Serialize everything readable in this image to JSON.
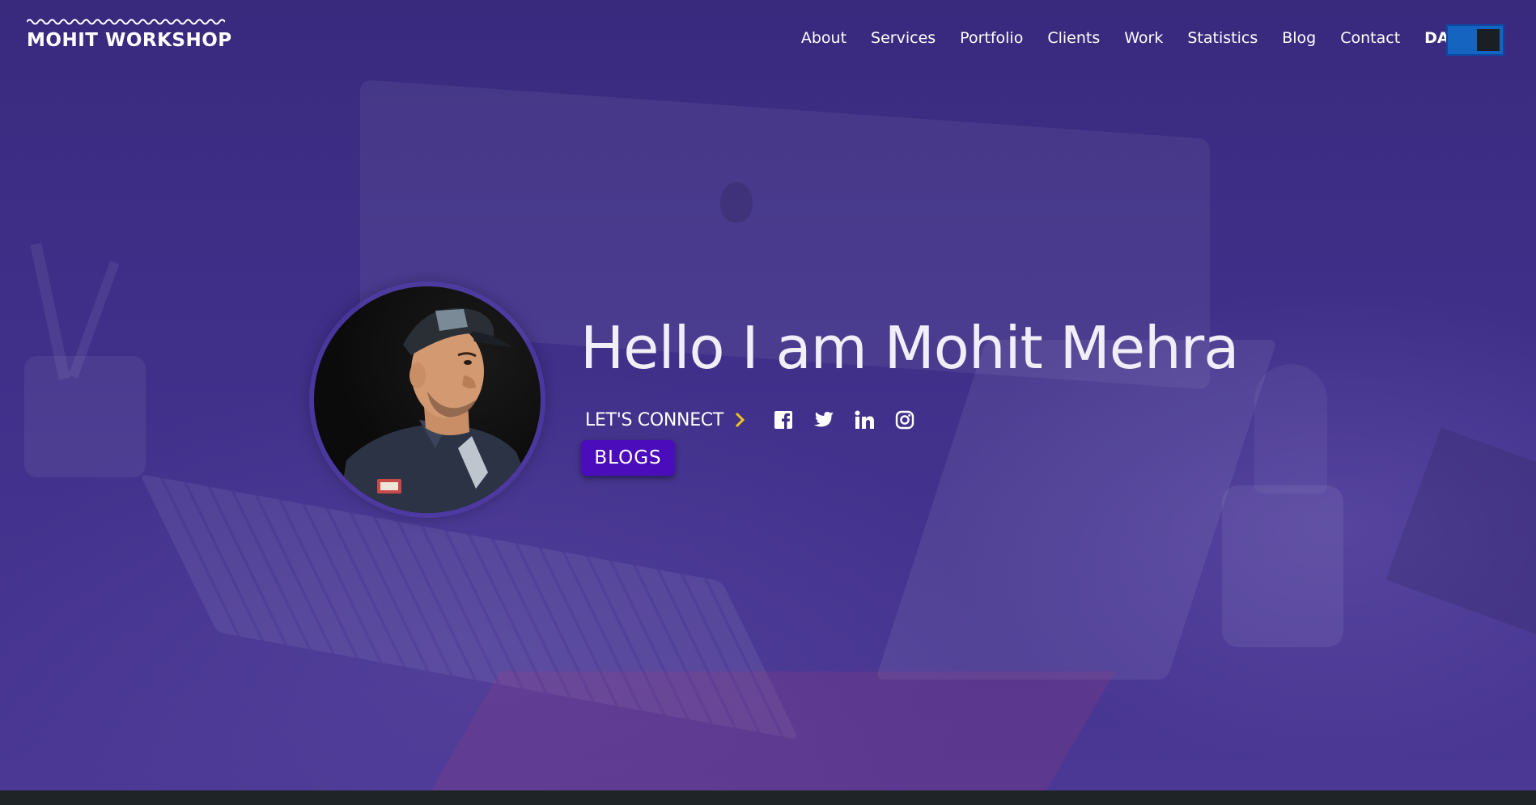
{
  "brand": {
    "name": "MOHIT WORKSHOP"
  },
  "nav": {
    "items": [
      "About",
      "Services",
      "Portfolio",
      "Clients",
      "Work",
      "Statistics",
      "Blog",
      "Contact"
    ],
    "mode_label": "DARK"
  },
  "hero": {
    "title": "Hello I am Mohit Mehra",
    "connect_label": "LET'S CONNECT",
    "blogs_button": "BLOGS",
    "social_icons": [
      "facebook-icon",
      "twitter-icon",
      "linkedin-icon",
      "instagram-icon"
    ]
  },
  "colors": {
    "background": "#3f2d85",
    "toggle": "#1565c0",
    "button": "#4b0cbb",
    "chevron": "#f5c518",
    "footer": "#1f2426"
  }
}
